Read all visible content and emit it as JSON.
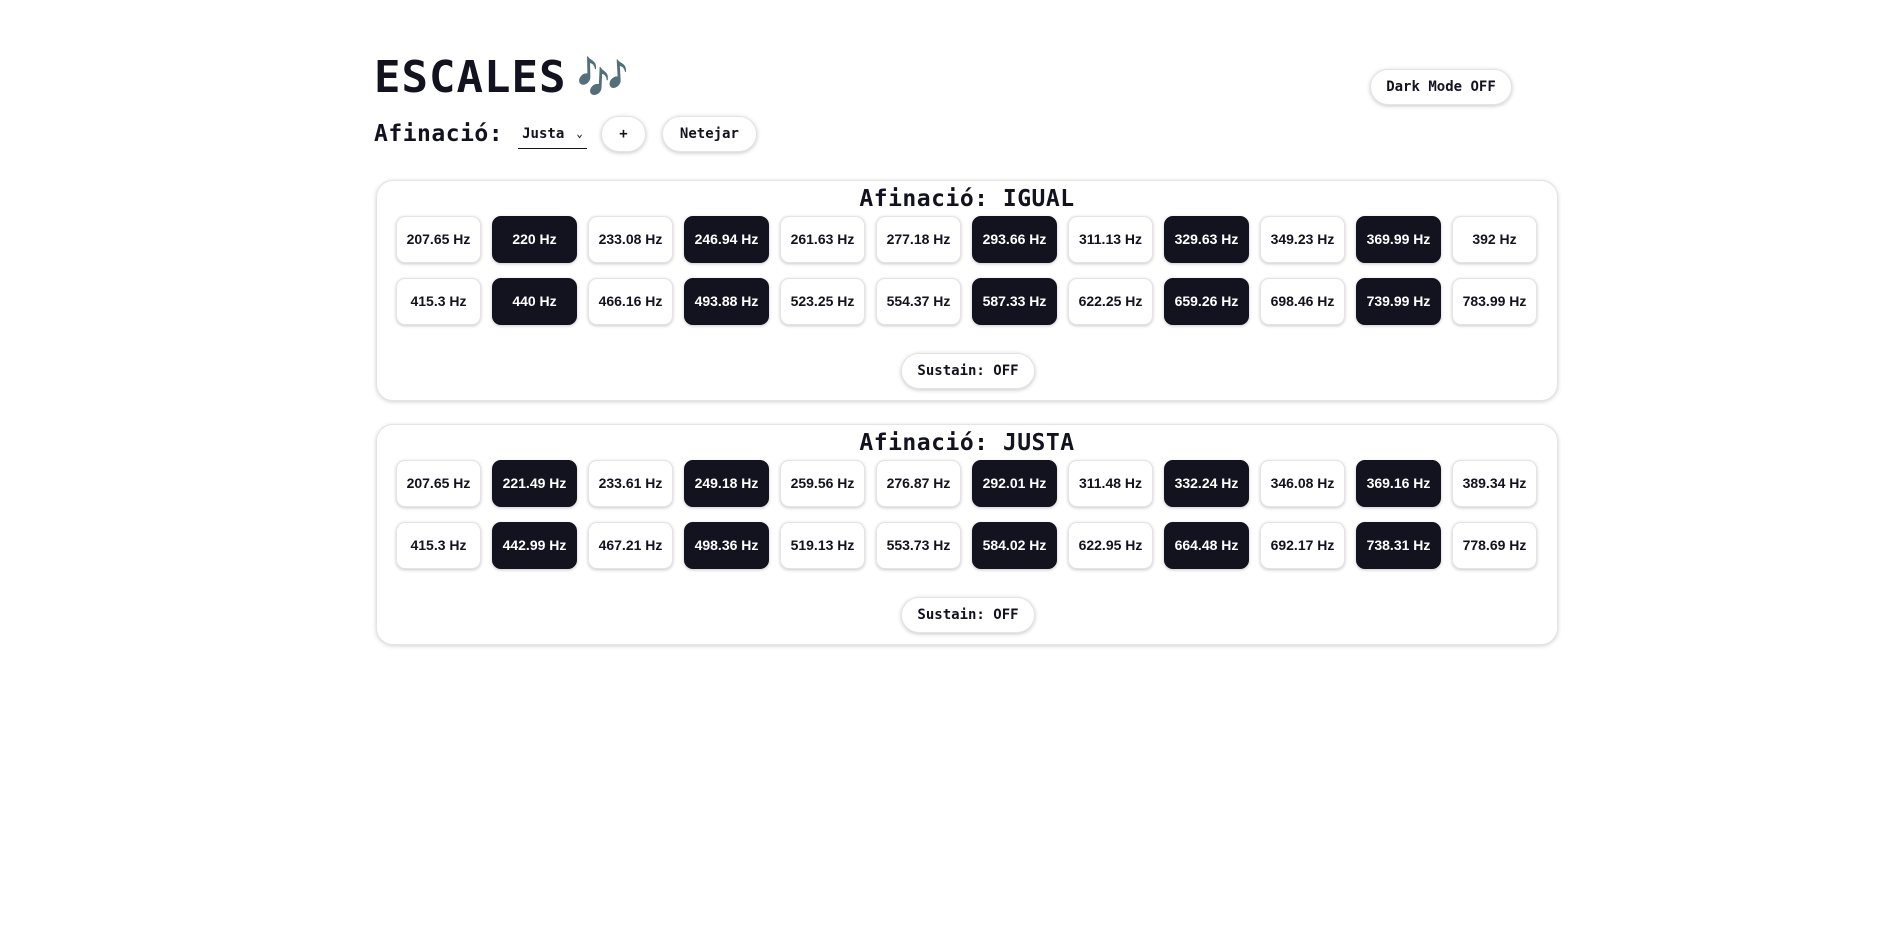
{
  "app": {
    "title": "ESCALES",
    "title_icon": "🎶",
    "tuning_label": "Afinació:",
    "tuning_select_value": "Justa",
    "add_label": "+",
    "clear_label": "Netejar",
    "dark_mode_label": "Dark Mode OFF"
  },
  "colors": {
    "text": "#13121f",
    "black_key": "#13121f",
    "white_key": "#ffffff",
    "background": "#ffffff"
  },
  "panels": [
    {
      "title": "Afinació: IGUAL",
      "sustain_label": "Sustain: OFF",
      "keys": [
        {
          "label": "207.65 Hz",
          "type": "white"
        },
        {
          "label": "220 Hz",
          "type": "black"
        },
        {
          "label": "233.08 Hz",
          "type": "white"
        },
        {
          "label": "246.94 Hz",
          "type": "black"
        },
        {
          "label": "261.63 Hz",
          "type": "white"
        },
        {
          "label": "277.18 Hz",
          "type": "white"
        },
        {
          "label": "293.66 Hz",
          "type": "black"
        },
        {
          "label": "311.13 Hz",
          "type": "white"
        },
        {
          "label": "329.63 Hz",
          "type": "black"
        },
        {
          "label": "349.23 Hz",
          "type": "white"
        },
        {
          "label": "369.99 Hz",
          "type": "black"
        },
        {
          "label": "392 Hz",
          "type": "white"
        },
        {
          "label": "415.3 Hz",
          "type": "white"
        },
        {
          "label": "440 Hz",
          "type": "black"
        },
        {
          "label": "466.16 Hz",
          "type": "white"
        },
        {
          "label": "493.88 Hz",
          "type": "black"
        },
        {
          "label": "523.25 Hz",
          "type": "white"
        },
        {
          "label": "554.37 Hz",
          "type": "white"
        },
        {
          "label": "587.33 Hz",
          "type": "black"
        },
        {
          "label": "622.25 Hz",
          "type": "white"
        },
        {
          "label": "659.26 Hz",
          "type": "black"
        },
        {
          "label": "698.46 Hz",
          "type": "white"
        },
        {
          "label": "739.99 Hz",
          "type": "black"
        },
        {
          "label": "783.99 Hz",
          "type": "white"
        }
      ]
    },
    {
      "title": "Afinació: JUSTA",
      "sustain_label": "Sustain: OFF",
      "keys": [
        {
          "label": "207.65 Hz",
          "type": "white"
        },
        {
          "label": "221.49 Hz",
          "type": "black"
        },
        {
          "label": "233.61 Hz",
          "type": "white"
        },
        {
          "label": "249.18 Hz",
          "type": "black"
        },
        {
          "label": "259.56 Hz",
          "type": "white"
        },
        {
          "label": "276.87 Hz",
          "type": "white"
        },
        {
          "label": "292.01 Hz",
          "type": "black"
        },
        {
          "label": "311.48 Hz",
          "type": "white"
        },
        {
          "label": "332.24 Hz",
          "type": "black"
        },
        {
          "label": "346.08 Hz",
          "type": "white"
        },
        {
          "label": "369.16 Hz",
          "type": "black"
        },
        {
          "label": "389.34 Hz",
          "type": "white"
        },
        {
          "label": "415.3 Hz",
          "type": "white"
        },
        {
          "label": "442.99 Hz",
          "type": "black"
        },
        {
          "label": "467.21 Hz",
          "type": "white"
        },
        {
          "label": "498.36 Hz",
          "type": "black"
        },
        {
          "label": "519.13 Hz",
          "type": "white"
        },
        {
          "label": "553.73 Hz",
          "type": "white"
        },
        {
          "label": "584.02 Hz",
          "type": "black"
        },
        {
          "label": "622.95 Hz",
          "type": "white"
        },
        {
          "label": "664.48 Hz",
          "type": "black"
        },
        {
          "label": "692.17 Hz",
          "type": "white"
        },
        {
          "label": "738.31 Hz",
          "type": "black"
        },
        {
          "label": "778.69 Hz",
          "type": "white"
        }
      ]
    }
  ]
}
